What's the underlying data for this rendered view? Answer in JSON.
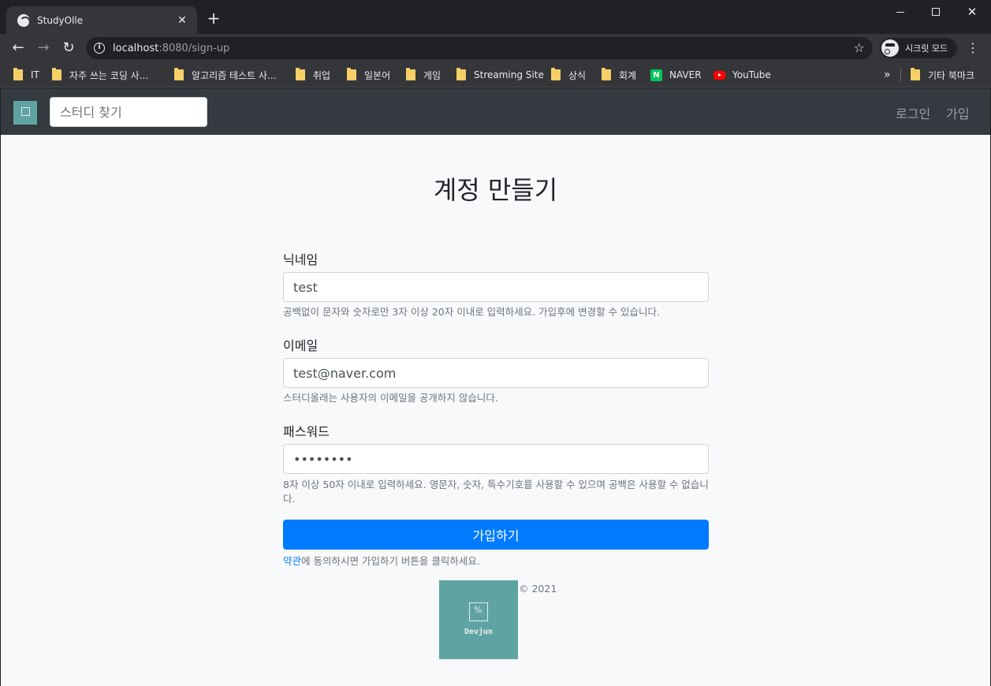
{
  "browser": {
    "tab_title": "StudyOlle",
    "url_host": "localhost",
    "url_rest": ":8080/sign-up",
    "incognito_label": "시크릿 모드",
    "bookmarks": [
      {
        "label": "IT",
        "icon": "folder-icon"
      },
      {
        "label": "자주 쓰는 코딩 사...",
        "icon": "folder-icon"
      },
      {
        "label": "알고리즘 테스트 사...",
        "icon": "folder-icon"
      },
      {
        "label": "취업",
        "icon": "folder-icon"
      },
      {
        "label": "일본어",
        "icon": "folder-icon"
      },
      {
        "label": "게임",
        "icon": "folder-icon"
      },
      {
        "label": "Streaming Site",
        "icon": "folder-icon"
      },
      {
        "label": "상식",
        "icon": "folder-icon"
      },
      {
        "label": "회계",
        "icon": "folder-icon"
      },
      {
        "label": "NAVER",
        "icon": "naver-icon"
      },
      {
        "label": "YouTube",
        "icon": "youtube-icon"
      }
    ],
    "more_bookmarks_label": "»",
    "other_bookmarks_label": "기타 북마크"
  },
  "navbar": {
    "search_placeholder": "스터디 찾기",
    "login_label": "로그인",
    "signup_label": "가입"
  },
  "form": {
    "title": "계정 만들기",
    "nickname": {
      "label": "닉네임",
      "value": "test",
      "help": "공백없이 문자와 숫자로만 3자 이상 20자 이내로 입력하세요. 가입후에 변경할 수 있습니다."
    },
    "email": {
      "label": "이메일",
      "value": "test@naver.com",
      "help": "스터디올래는 사용자의 이메일을 공개하지 않습니다."
    },
    "password": {
      "label": "패스워드",
      "value": "testtest",
      "help": "8자 이상 50자 이내로 입력하세요. 영문자, 숫자, 특수기호를 사용할 수 있으며 공백은 사용할 수 없습니다."
    },
    "submit_label": "가입하기",
    "terms_link": "약관",
    "terms_rest": "에 동의하시면 가입하기 버튼을 클릭하세요."
  },
  "footer": {
    "logo_text": "Devjun",
    "copyright": "© 2021"
  },
  "colors": {
    "primary": "#007bff",
    "navbar_bg": "#343a40",
    "logo_bg": "#5fa4a3"
  }
}
